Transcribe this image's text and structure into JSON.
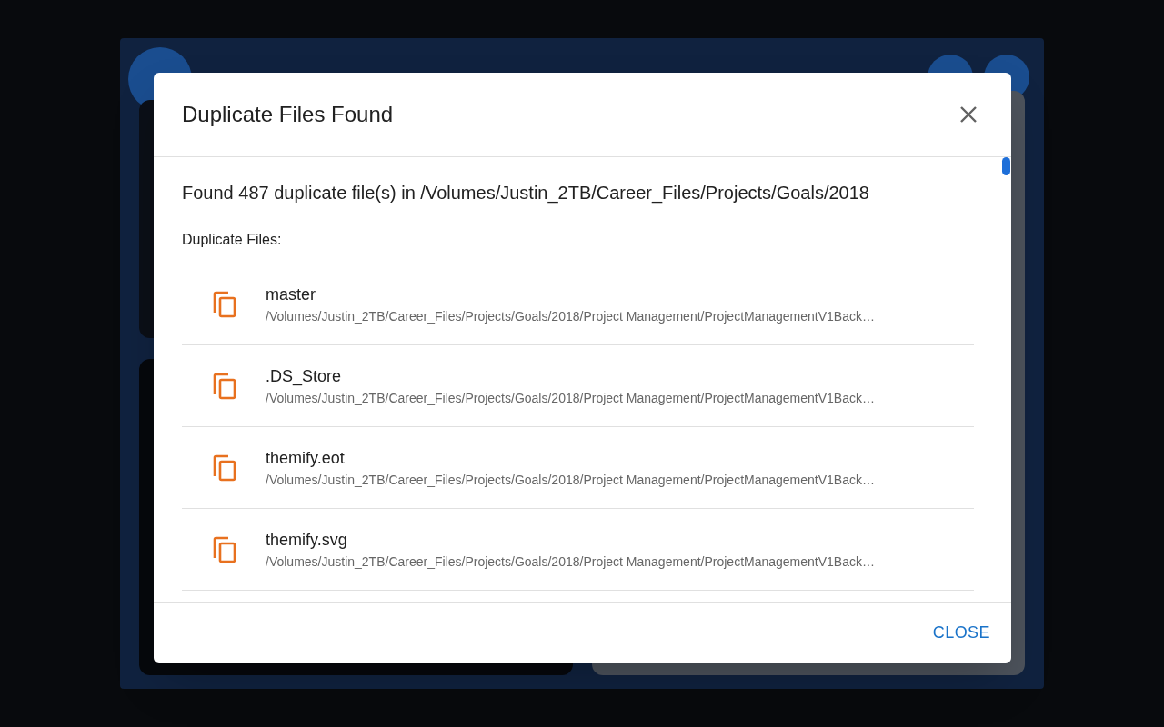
{
  "dialog": {
    "title": "Duplicate Files Found",
    "summary": "Found 487 duplicate file(s) in /Volumes/Justin_2TB/Career_Files/Projects/Goals/2018",
    "list_heading": "Duplicate Files:",
    "files": [
      {
        "name": "master",
        "path": "/Volumes/Justin_2TB/Career_Files/Projects/Goals/2018/Project Management/ProjectManagementV1Back…"
      },
      {
        "name": ".DS_Store",
        "path": "/Volumes/Justin_2TB/Career_Files/Projects/Goals/2018/Project Management/ProjectManagementV1Back…"
      },
      {
        "name": "themify.eot",
        "path": "/Volumes/Justin_2TB/Career_Files/Projects/Goals/2018/Project Management/ProjectManagementV1Back…"
      },
      {
        "name": "themify.svg",
        "path": "/Volumes/Justin_2TB/Career_Files/Projects/Goals/2018/Project Management/ProjectManagementV1Back…"
      }
    ],
    "close_button": "CLOSE"
  }
}
